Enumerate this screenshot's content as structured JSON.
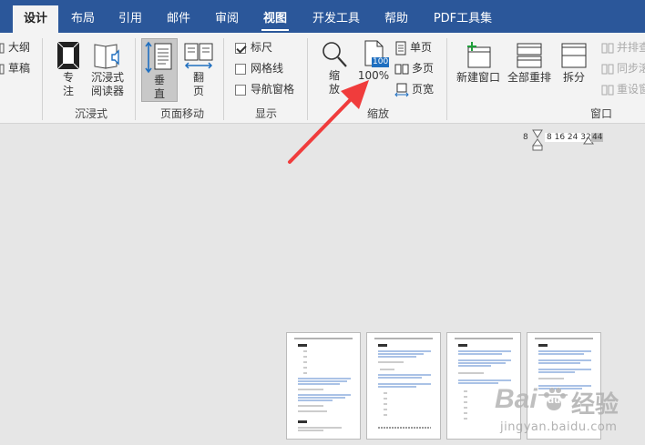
{
  "tabs": [
    "设计",
    "布局",
    "引用",
    "邮件",
    "审阅",
    "视图",
    "开发工具",
    "帮助",
    "PDF工具集"
  ],
  "ribbon": {
    "left_partial": {
      "outline": "大纲",
      "draft": "草稿"
    },
    "immersive": {
      "label": "沉浸式",
      "focus": "专\n注",
      "reader": "沉浸式\n阅读器"
    },
    "page_movement": {
      "label": "页面移动",
      "vertical": "垂\n直",
      "side": "翻\n页"
    },
    "show": {
      "label": "显示",
      "ruler": "标尺",
      "gridlines": "网格线",
      "nav_pane": "导航窗格",
      "ruler_checked": true
    },
    "zoom": {
      "label": "缩放",
      "zoom_btn": "缩\n放",
      "hundred": "100%",
      "hundred_icon_text": "100",
      "one_page": "单页",
      "multi_page": "多页",
      "page_width": "页宽"
    },
    "window": {
      "label": "窗口",
      "new_window": "新建窗口",
      "arrange_all": "全部重排",
      "split": "拆分",
      "side_by_side": "并排查",
      "sync_scroll": "同步滚",
      "reset_pos": "重设窗"
    }
  },
  "ruler": {
    "left": "8",
    "marks": "8  16 24 32",
    "right": "44"
  },
  "watermark": {
    "brand": "Bai",
    "paw": "du",
    "cn": "经验",
    "url": "jingyan.baidu.com"
  },
  "colors": {
    "accent": "#2b579a",
    "arrow": "#f03c3c",
    "link": "#1f5fbf"
  }
}
